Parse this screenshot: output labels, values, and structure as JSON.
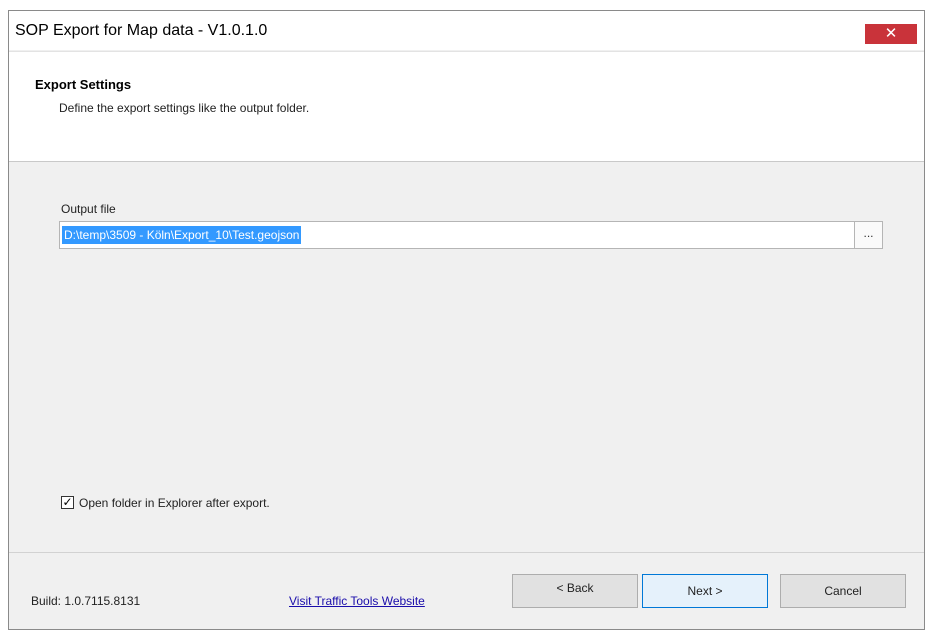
{
  "window": {
    "title": "SOP Export for Map data - V1.0.1.0",
    "close_glyph": "✕"
  },
  "header": {
    "title": "Export Settings",
    "subtitle": "Define the export settings like the output folder."
  },
  "output": {
    "label": "Output file",
    "value": "D:\\temp\\3509 - Köln\\Export_10\\Test.geojson",
    "browse_label": "..."
  },
  "options": {
    "open_folder_label": "Open folder in Explorer after export.",
    "open_folder_checked": true,
    "check_glyph": "✓"
  },
  "footer": {
    "build": "Build: 1.0.7115.8131",
    "website_link": "Visit Traffic Tools Website",
    "back_label": "< Back",
    "next_label": "Next >",
    "cancel_label": "Cancel"
  },
  "colors": {
    "close_button": "#c9333a",
    "selection": "#3399ff",
    "link": "#1a0dab",
    "focused_button_border": "#0078d7"
  }
}
